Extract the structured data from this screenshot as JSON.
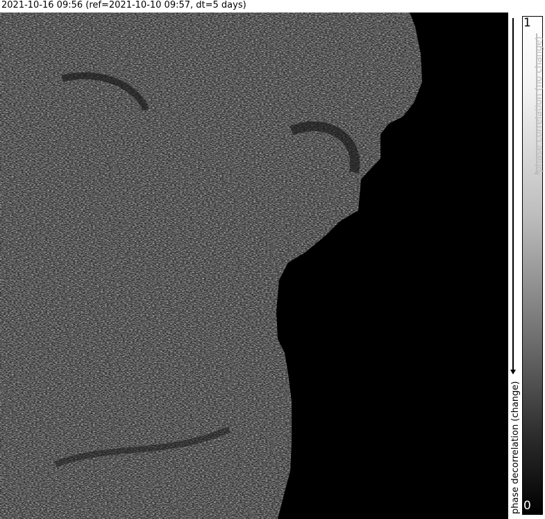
{
  "header": {
    "title": "2021-10-16 09:56 (ref=2021-10-10 09:57, dt=5 days)"
  },
  "legend": {
    "max_label": "1",
    "min_label": "0",
    "top_caption": "phase correlation (no change)",
    "bottom_caption": "phase decorrelation (change)",
    "colors": {
      "high": "#ffffff",
      "low": "#000000",
      "background": "#000000"
    }
  }
}
